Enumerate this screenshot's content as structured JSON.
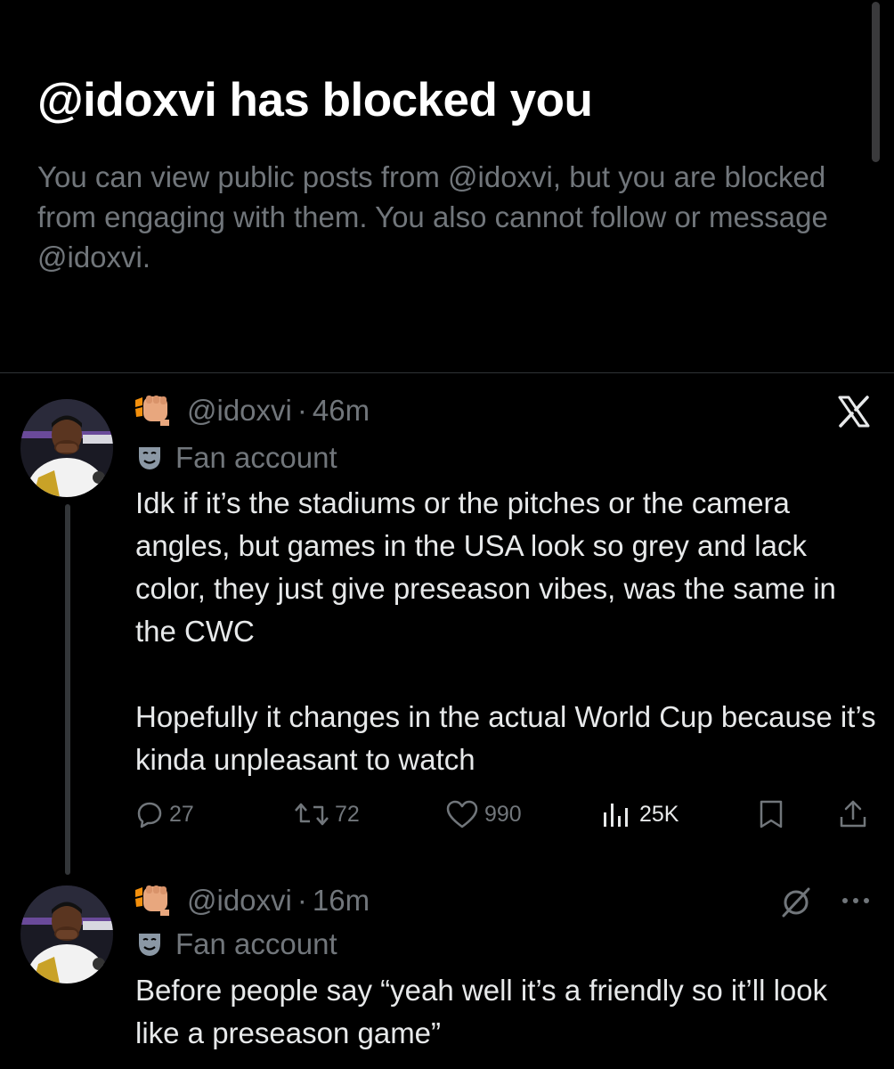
{
  "blocked_notice": {
    "title": "@idoxvi has blocked you",
    "description": "You can view public posts from @idoxvi, but you are blocked from engaging with them. You also cannot follow or message @idoxvi."
  },
  "posts": [
    {
      "handle": "@idoxvi",
      "separator": "·",
      "time": "46m",
      "label": "Fan account",
      "text": "Idk if it’s the stadiums or the pitches or the camera angles, but games in the USA look so grey and lack color, they just give preseason vibes, was the same in the CWC\n\nHopefully it changes in the actual World Cup because it’s kinda unpleasant to watch",
      "top_right_icon": "x-logo-icon",
      "replies": "27",
      "reposts": "72",
      "likes": "990",
      "views": "25K"
    },
    {
      "handle": "@idoxvi",
      "separator": "·",
      "time": "16m",
      "label": "Fan account",
      "text": "Before people say “yeah well it’s a friendly so it’ll look like a preseason game”",
      "top_right_icons": [
        "grok-icon",
        "more-icon"
      ]
    }
  ],
  "colors": {
    "background": "#000000",
    "primary_text": "#e7e9ea",
    "secondary_text": "#71767b",
    "divider": "#2f3336"
  }
}
